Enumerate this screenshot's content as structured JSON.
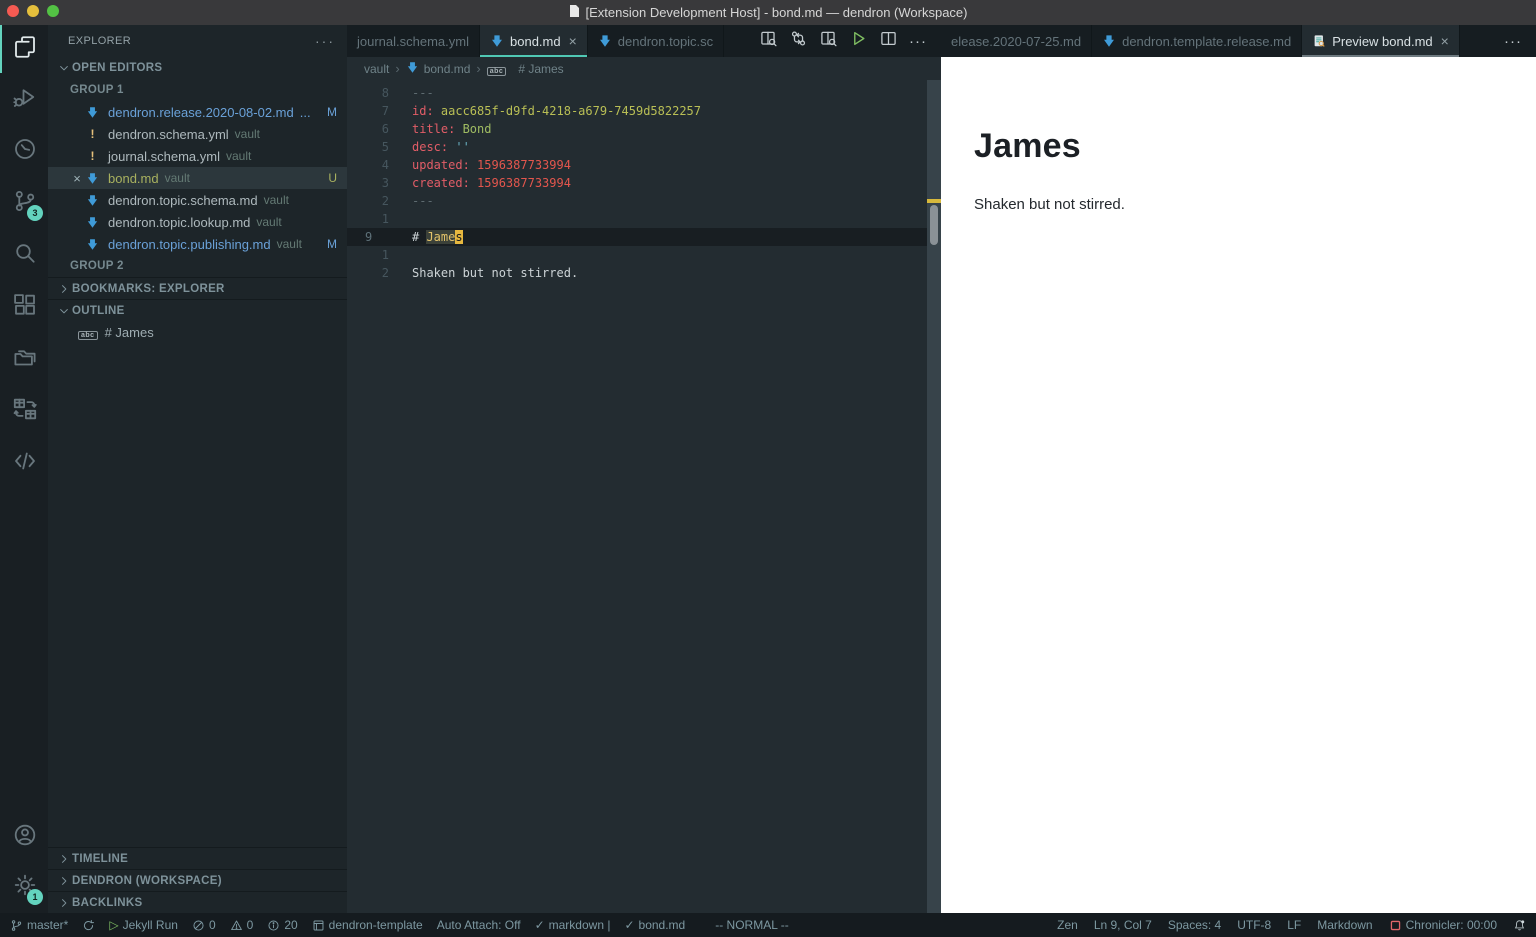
{
  "window": {
    "title": "[Extension Development Host] - bond.md — dendron (Workspace)"
  },
  "colors": {
    "accent_teal": "#50c8b4",
    "dendron_blue": "#3f9bd8",
    "modified_blue": "#6aa1d8",
    "untracked_green": "#a8b15f",
    "preview_bg": "#ffffff",
    "cursor_yellow": "#e7b83f"
  },
  "activity_bar": {
    "top": [
      {
        "name": "explorer",
        "active": true
      },
      {
        "name": "run-debug",
        "active": false
      },
      {
        "name": "clock",
        "active": false
      },
      {
        "name": "source-control",
        "active": false,
        "badge": "3"
      },
      {
        "name": "search",
        "active": false
      },
      {
        "name": "extensions",
        "active": false
      },
      {
        "name": "folders",
        "active": false
      },
      {
        "name": "table-layout",
        "active": false
      },
      {
        "name": "code",
        "active": false
      }
    ],
    "bottom": [
      {
        "name": "account",
        "active": false
      },
      {
        "name": "settings",
        "active": false,
        "badge": "1"
      }
    ]
  },
  "sidebar": {
    "title": "EXPLORER",
    "header_more": "···",
    "open_editors": {
      "label": "OPEN EDITORS",
      "groups": [
        {
          "label": "GROUP 1",
          "items": [
            {
              "icon": "dendron",
              "name": "dendron.release.2020-08-02.md",
              "trail": "...",
              "badge": "M",
              "state": "mod",
              "selected": false
            },
            {
              "icon": "exclaim",
              "name": "dendron.schema.yml",
              "suffix": "vault",
              "state": "",
              "selected": false
            },
            {
              "icon": "exclaim",
              "name": "journal.schema.yml",
              "suffix": "vault",
              "state": "",
              "selected": false
            },
            {
              "close": "×",
              "icon": "dendron",
              "name": "bond.md",
              "suffix": "vault",
              "badge": "U",
              "state": "unt",
              "selected": true
            },
            {
              "icon": "dendron",
              "name": "dendron.topic.schema.md",
              "suffix": "vault",
              "state": "",
              "selected": false
            },
            {
              "icon": "dendron",
              "name": "dendron.topic.lookup.md",
              "suffix": "vault",
              "state": "",
              "selected": false
            },
            {
              "icon": "dendron",
              "name": "dendron.topic.publishing.md",
              "suffix": "vault",
              "badge": "M",
              "state": "mod",
              "selected": false
            }
          ]
        },
        {
          "label": "GROUP 2",
          "items": []
        }
      ]
    },
    "sections": [
      {
        "label": "BOOKMARKS: EXPLORER",
        "chevron": "right"
      },
      {
        "label": "OUTLINE",
        "chevron": "down"
      }
    ],
    "outline_items": [
      {
        "icon": "abc",
        "label": "# James"
      }
    ],
    "bottom_sections": [
      {
        "label": "TIMELINE",
        "chevron": "right"
      },
      {
        "label": "DENDRON (WORKSPACE)",
        "chevron": "right"
      },
      {
        "label": "BACKLINKS",
        "chevron": "right"
      }
    ]
  },
  "editor": {
    "groups": [
      {
        "tabs": [
          {
            "label": "journal.schema.yml",
            "icon": "",
            "active": false,
            "close": ""
          },
          {
            "label": "bond.md",
            "icon": "dendron",
            "active": true,
            "close": "×"
          },
          {
            "label": "dendron.topic.sc",
            "icon": "dendron",
            "active": false,
            "close": ""
          }
        ],
        "actions": [
          "open-preview-side",
          "git-compare",
          "open-preview",
          "run",
          "split-editor",
          "more-actions"
        ]
      },
      {
        "tabs": [
          {
            "label": "elease.2020-07-25.md",
            "icon": "",
            "active": false,
            "close": ""
          },
          {
            "label": "dendron.template.release.md",
            "icon": "dendron",
            "active": false,
            "close": ""
          },
          {
            "label": "Preview bond.md",
            "icon": "preview",
            "active": true,
            "close": "×"
          }
        ],
        "actions": [
          "more-actions"
        ]
      }
    ],
    "breadcrumbs": [
      {
        "label": "vault",
        "icon": ""
      },
      {
        "label": "bond.md",
        "icon": "dendron"
      },
      {
        "label": "# James",
        "icon": "abc"
      }
    ],
    "lines": [
      {
        "num": "8",
        "current": false,
        "tokens": [
          {
            "t": "---",
            "c": "meta"
          }
        ]
      },
      {
        "num": "7",
        "current": false,
        "tokens": [
          {
            "t": "id",
            "c": "key"
          },
          {
            "t": ": ",
            "c": "key"
          },
          {
            "t": "aacc685f-d9fd-4218-a679-7459d5822257",
            "c": "val"
          }
        ]
      },
      {
        "num": "6",
        "current": false,
        "tokens": [
          {
            "t": "title",
            "c": "key"
          },
          {
            "t": ": ",
            "c": "key"
          },
          {
            "t": "Bond",
            "c": "val2"
          }
        ]
      },
      {
        "num": "5",
        "current": false,
        "tokens": [
          {
            "t": "desc",
            "c": "key"
          },
          {
            "t": ": ",
            "c": "key"
          },
          {
            "t": "''",
            "c": "str"
          }
        ]
      },
      {
        "num": "4",
        "current": false,
        "tokens": [
          {
            "t": "updated",
            "c": "key"
          },
          {
            "t": ": ",
            "c": "key"
          },
          {
            "t": "1596387733994",
            "c": "num"
          }
        ]
      },
      {
        "num": "3",
        "current": false,
        "tokens": [
          {
            "t": "created",
            "c": "key"
          },
          {
            "t": ": ",
            "c": "key"
          },
          {
            "t": "1596387733994",
            "c": "num"
          }
        ]
      },
      {
        "num": "2",
        "current": false,
        "tokens": [
          {
            "t": "---",
            "c": "meta"
          }
        ]
      },
      {
        "num": "1",
        "current": false,
        "tokens": []
      },
      {
        "num": "9",
        "current": true,
        "tokens": [
          {
            "t": "# ",
            "c": "plain"
          },
          {
            "t": "Jame",
            "c": "selword"
          },
          {
            "t": "s",
            "c": "cursor"
          }
        ]
      },
      {
        "num": "1",
        "current": false,
        "tokens": []
      },
      {
        "num": "2",
        "current": false,
        "tokens": [
          {
            "t": "Shaken but not stirred.",
            "c": "plain"
          }
        ]
      }
    ]
  },
  "preview": {
    "heading": "James",
    "body": "Shaken but not stirred."
  },
  "status_bar": {
    "left": [
      {
        "name": "git-branch",
        "icon": "branch",
        "text": "master*"
      },
      {
        "name": "sync",
        "icon": "sync",
        "text": ""
      },
      {
        "name": "jekyll-run",
        "icon": "play",
        "text": "Jekyll Run"
      },
      {
        "name": "errors",
        "icon": "error",
        "text": "0"
      },
      {
        "name": "warnings",
        "icon": "warning",
        "text": "0"
      },
      {
        "name": "infos",
        "icon": "info",
        "text": "20"
      },
      {
        "name": "workspace-name",
        "icon": "notebook",
        "text": "dendron-template"
      },
      {
        "name": "auto-attach",
        "icon": "",
        "text": "Auto Attach: Off"
      },
      {
        "name": "markdown-check",
        "icon": "check",
        "text": "markdown |"
      },
      {
        "name": "bond-check",
        "icon": "check",
        "text": "bond.md"
      },
      {
        "name": "vim-mode",
        "icon": "",
        "text": "-- NORMAL --"
      }
    ],
    "right": [
      {
        "name": "zen",
        "icon": "",
        "text": "Zen"
      },
      {
        "name": "cursor-position",
        "icon": "",
        "text": "Ln 9, Col 7"
      },
      {
        "name": "indentation",
        "icon": "",
        "text": "Spaces: 4"
      },
      {
        "name": "encoding",
        "icon": "",
        "text": "UTF-8"
      },
      {
        "name": "eol",
        "icon": "",
        "text": "LF"
      },
      {
        "name": "language-mode",
        "icon": "",
        "text": "Markdown"
      },
      {
        "name": "chronicler",
        "icon": "chronicler",
        "text": "Chronicler: 00:00"
      },
      {
        "name": "notifications",
        "icon": "bell",
        "text": ""
      }
    ]
  }
}
